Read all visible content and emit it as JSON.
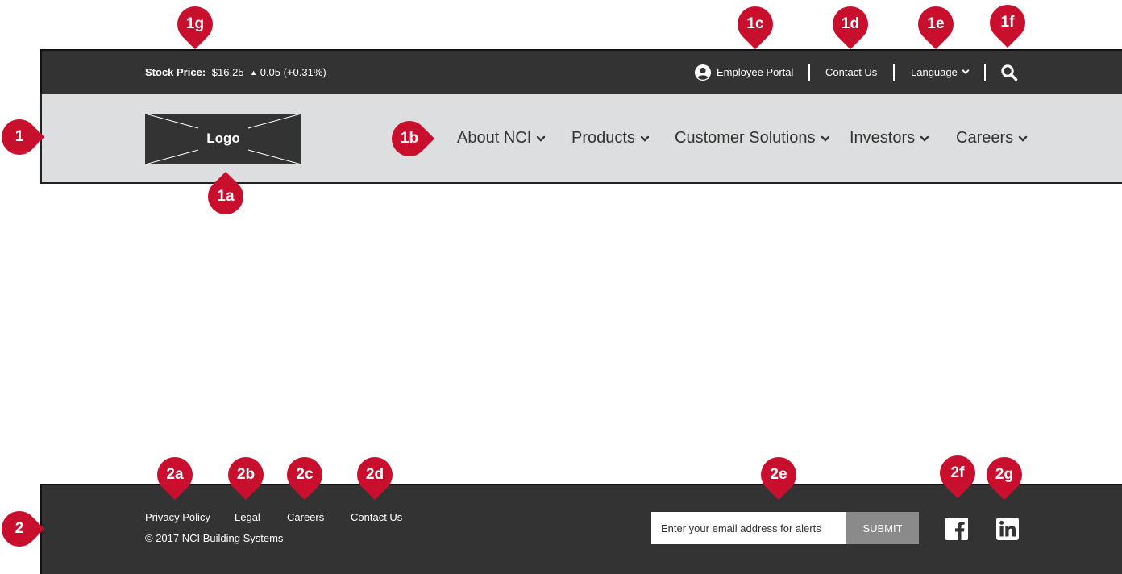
{
  "header": {
    "stock": {
      "label": "Stock Price:",
      "price": "$16.25",
      "change": "0.05 (+0.31%)"
    },
    "utility_links": {
      "employee_portal": "Employee Portal",
      "contact_us": "Contact Us",
      "language": "Language"
    },
    "logo_text": "Logo",
    "nav": [
      {
        "label": "About NCI"
      },
      {
        "label": "Products"
      },
      {
        "label": "Customer Solutions"
      },
      {
        "label": "Investors"
      },
      {
        "label": "Careers"
      }
    ]
  },
  "footer": {
    "links": [
      {
        "label": "Privacy Policy"
      },
      {
        "label": "Legal"
      },
      {
        "label": "Careers"
      },
      {
        "label": "Contact Us"
      }
    ],
    "copyright": "© 2017 NCI Building Systems",
    "email_placeholder": "Enter your email address for alerts",
    "submit_label": "SUBMIT",
    "social_icons": [
      "facebook-icon",
      "linkedin-icon"
    ]
  },
  "annotations": {
    "1": "1",
    "1a": "1a",
    "1b": "1b",
    "1c": "1c",
    "1d": "1d",
    "1e": "1e",
    "1f": "1f",
    "1g": "1g",
    "2": "2",
    "2a": "2a",
    "2b": "2b",
    "2c": "2c",
    "2d": "2d",
    "2e": "2e",
    "2f": "2f",
    "2g": "2g"
  },
  "colors": {
    "dark_bar": "#333333",
    "nav_bg": "#dddedf",
    "marker_red": "#c8102e",
    "submit_bg": "#8a8a8a"
  }
}
